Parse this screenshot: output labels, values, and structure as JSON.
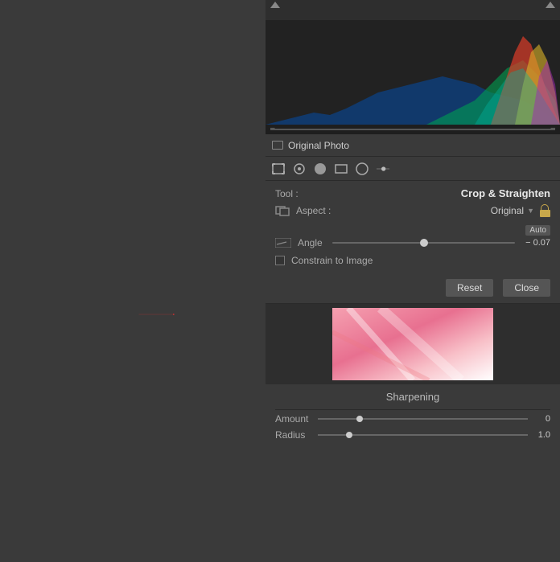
{
  "left_panel": {
    "bg_color": "#3a3a3a"
  },
  "right_panel": {
    "original_photo_label": "Original Photo",
    "tools": [
      {
        "name": "crop-tool",
        "type": "rect-corners",
        "active": false
      },
      {
        "name": "spot-removal",
        "type": "circle-dot",
        "active": false
      },
      {
        "name": "redeye",
        "type": "circle-filled",
        "active": true
      },
      {
        "name": "graduated",
        "type": "rect",
        "active": false
      },
      {
        "name": "radial",
        "type": "circle-outline",
        "active": false
      },
      {
        "name": "adjustment",
        "type": "slider",
        "active": false
      }
    ],
    "crop": {
      "tool_label": "Tool :",
      "tool_value": "Crop & Straighten",
      "aspect_label": "Aspect :",
      "aspect_value": "Original",
      "auto_label": "Auto",
      "angle_label": "Angle",
      "angle_value": "− 0.07",
      "angle_thumb_pct": 50,
      "constrain_label": "Constrain to Image",
      "reset_label": "Reset",
      "close_label": "Close"
    },
    "sharpening": {
      "title": "Sharpening",
      "amount_label": "Amount",
      "amount_value": "0",
      "amount_thumb_pct": 20,
      "radius_label": "Radius",
      "radius_value": "1.0",
      "radius_thumb_pct": 15
    }
  }
}
